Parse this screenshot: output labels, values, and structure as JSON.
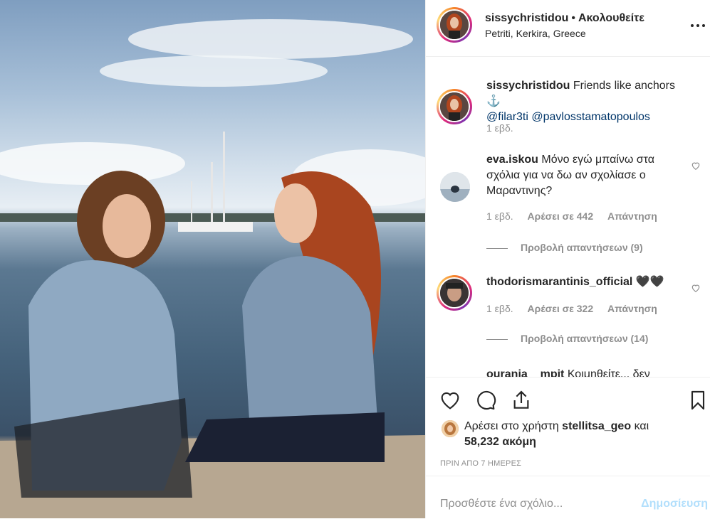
{
  "header": {
    "username": "sissychristidou",
    "separator": "•",
    "follow_label": "Ακολουθείτε",
    "location": "Petriti, Kerkira, Greece",
    "more_icon": "more-dots-icon"
  },
  "caption": {
    "username": "sissychristidou",
    "text": "Friends like anchors ⚓",
    "mention_1": "@filar3ti",
    "mention_2": "@pavlosstamatopoulos",
    "time": "1 εβδ."
  },
  "comments": [
    {
      "username": "eva.iskou",
      "text": "Μόνο εγώ μπαίνω στα σχόλια για να δω αν σχολίασε ο Μαραντινης?",
      "time": "1 εβδ.",
      "likes": "Αρέσει σε 442",
      "reply": "Απάντηση",
      "view_replies": "Προβολή απαντήσεων (9)"
    },
    {
      "username": "thodorismarantinis_official",
      "text": "🖤🖤",
      "time": "1 εβδ.",
      "likes": "Αρέσει σε 322",
      "reply": "Απάντηση",
      "view_replies": "Προβολή απαντήσεων (14)"
    },
    {
      "username": "ourania__mpit",
      "text": "Κοιμηθείτε... δεν"
    }
  ],
  "likes": {
    "prefix": "Αρέσει στο χρήστη",
    "user": "stellitsa_geo",
    "connector": "και",
    "count": "58,232 ακόμη"
  },
  "time_ago": "ΠΡΙΝ ΑΠΟ 7 ΗΜΕΡΕΣ",
  "add_comment": {
    "placeholder": "Προσθέστε ένα σχόλιο...",
    "post_label": "Δημοσίευση"
  },
  "colors": {
    "link": "#003569",
    "muted": "#8e8e8e",
    "post_disabled": "#b2dffc"
  }
}
